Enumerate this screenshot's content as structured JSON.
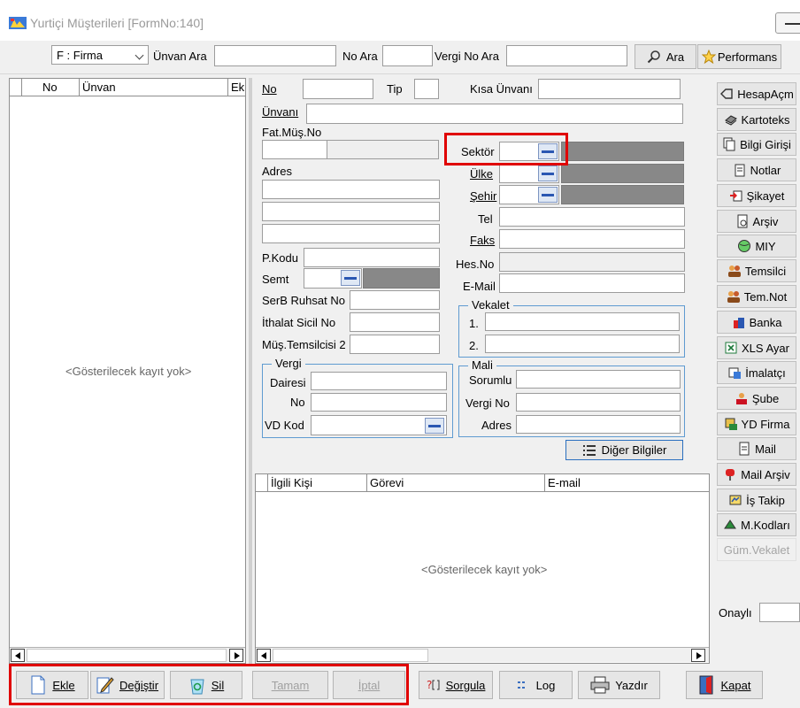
{
  "window": {
    "title": "Yurtiçi Müşterileri [FormNo:140]"
  },
  "search": {
    "type_select": "F : Firma",
    "unvan_ara_label": "Ünvan Ara",
    "no_ara_label": "No Ara",
    "vergi_no_ara_label": "Vergi No Ara",
    "unvan_ara_value": "",
    "no_ara_value": "",
    "vergi_no_ara_value": "",
    "ara_button": "Ara",
    "performans_button": "Performans"
  },
  "left_grid": {
    "columns": [
      "No",
      "Ünvan",
      "Ek"
    ],
    "empty_text": "<Gösterilecek kayıt yok>"
  },
  "form": {
    "no_label": "No",
    "tip_label": "Tip",
    "kisa_unvani_label": "Kısa Ünvanı",
    "unvani_label": "Ünvanı",
    "fat_mus_no_label": "Fat.Müş.No",
    "sektor_label": "Sektör",
    "ulke_label": "Ülke",
    "sehir_label": "Şehir",
    "adres_label": "Adres",
    "tel_label": "Tel",
    "faks_label": "Faks",
    "pkodu_label": "P.Kodu",
    "hes_no_label": "Hes.No",
    "semt_label": "Semt",
    "email_label": "E-Mail",
    "serb_ruhsat_label": "SerB Ruhsat No",
    "ithalat_sicil_label": "İthalat Sicil No",
    "mus_temsilcisi_label": "Müş.Temsilcisi 2",
    "vekalet": {
      "legend": "Vekalet",
      "row1": "1.",
      "row2": "2."
    },
    "vergi": {
      "legend": "Vergi",
      "dairesi": "Dairesi",
      "no": "No",
      "vd_kod": "VD Kod"
    },
    "mali": {
      "legend": "Mali",
      "sorumlu": "Sorumlu",
      "vergi_no": "Vergi No",
      "adres": "Adres"
    },
    "diger_bilgiler_button": "Diğer Bilgiler"
  },
  "contacts_grid": {
    "columns": [
      "İlgili Kişi",
      "Görevi",
      "E-mail"
    ],
    "empty_text": "<Gösterilecek kayıt yok>"
  },
  "side_buttons": [
    {
      "label": "HesapAçm",
      "icon": "tag-icon"
    },
    {
      "label": "Kartoteks",
      "icon": "cards-icon"
    },
    {
      "label": "Bilgi Girişi",
      "icon": "documents-icon"
    },
    {
      "label": "Notlar",
      "icon": "notes-icon"
    },
    {
      "label": "Şikayet",
      "icon": "complaint-icon"
    },
    {
      "label": "Arşiv",
      "icon": "archive-icon"
    },
    {
      "label": "MIY",
      "icon": "globe-icon"
    },
    {
      "label": "Temsilci",
      "icon": "people-icon"
    },
    {
      "label": "Tem.Not",
      "icon": "people-note-icon"
    },
    {
      "label": "Banka",
      "icon": "bank-icon"
    },
    {
      "label": "XLS Ayar",
      "icon": "excel-icon"
    },
    {
      "label": "İmalatçı",
      "icon": "factory-icon"
    },
    {
      "label": "Şube",
      "icon": "branch-icon"
    },
    {
      "label": "YD Firma",
      "icon": "foreign-firm-icon"
    },
    {
      "label": "Mail",
      "icon": "mail-icon"
    },
    {
      "label": "Mail Arşiv",
      "icon": "mailbox-icon"
    },
    {
      "label": "İş Takip",
      "icon": "tracking-icon"
    },
    {
      "label": "M.Kodları",
      "icon": "codes-icon"
    },
    {
      "label": "Güm.Vekalet",
      "icon": ""
    }
  ],
  "onayli_label": "Onaylı",
  "bottom_buttons": {
    "ekle": "Ekle",
    "degistir": "Değiştir",
    "sil": "Sil",
    "tamam": "Tamam",
    "iptal": "İptal",
    "sorgula": "Sorgula",
    "log": "Log",
    "yazdir": "Yazdır",
    "kapat": "Kapat"
  },
  "colors": {
    "highlight": "#e00000",
    "fieldset_border": "#5f9bd1",
    "lookup_blue": "#2a57b2"
  }
}
